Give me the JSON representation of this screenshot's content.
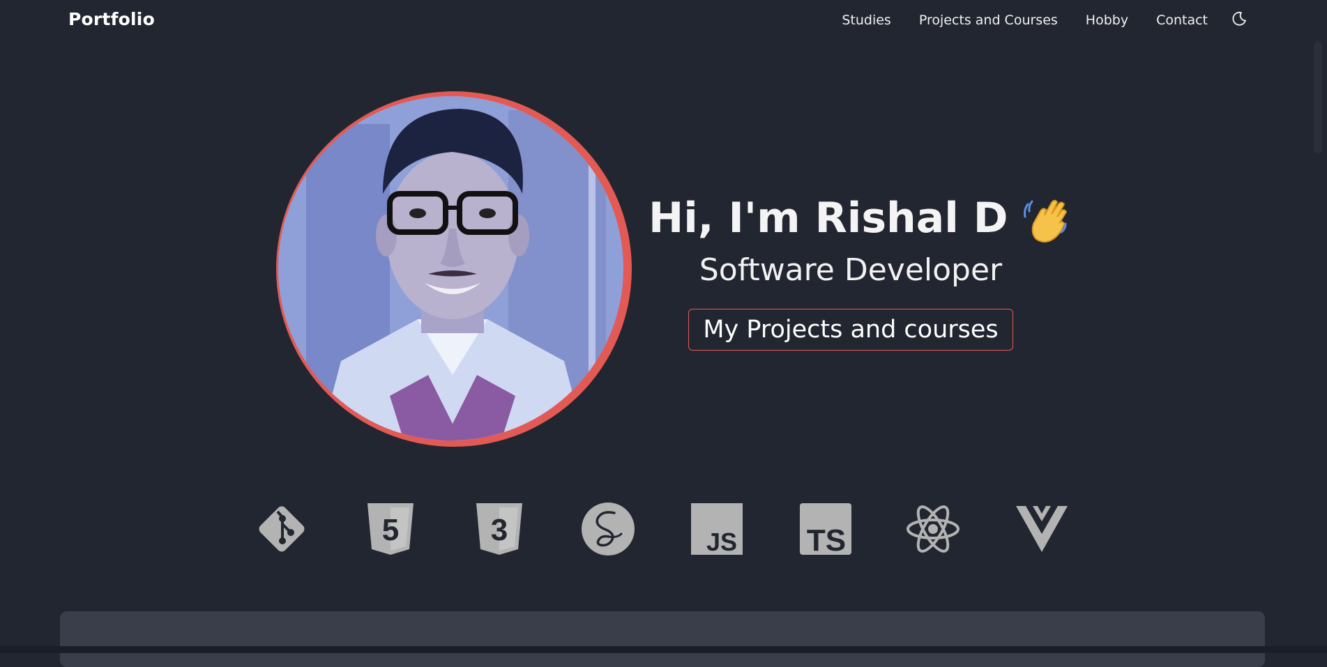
{
  "navbar": {
    "brand": "Portfolio",
    "links": [
      "Studies",
      "Projects and Courses",
      "Hobby",
      "Contact"
    ],
    "theme_icon": "moon-icon"
  },
  "hero": {
    "title": "Hi, I'm Rishal D",
    "wave_icon": "waving-hand-icon",
    "subtitle": "Software Developer",
    "cta_label": "My Projects and courses",
    "avatar": "profile-photo"
  },
  "skills": [
    {
      "name": "git-icon",
      "text": ""
    },
    {
      "name": "html5-icon",
      "text": "5"
    },
    {
      "name": "css3-icon",
      "text": "3"
    },
    {
      "name": "sass-icon",
      "text": ""
    },
    {
      "name": "javascript-icon",
      "text": "JS"
    },
    {
      "name": "typescript-icon",
      "text": "TS"
    },
    {
      "name": "react-icon",
      "text": ""
    },
    {
      "name": "vue-icon",
      "text": ""
    }
  ],
  "colors": {
    "background": "#222630",
    "accent": "#e35a55",
    "icon_gray": "#b3b3b3",
    "card": "#3a3e4a"
  }
}
